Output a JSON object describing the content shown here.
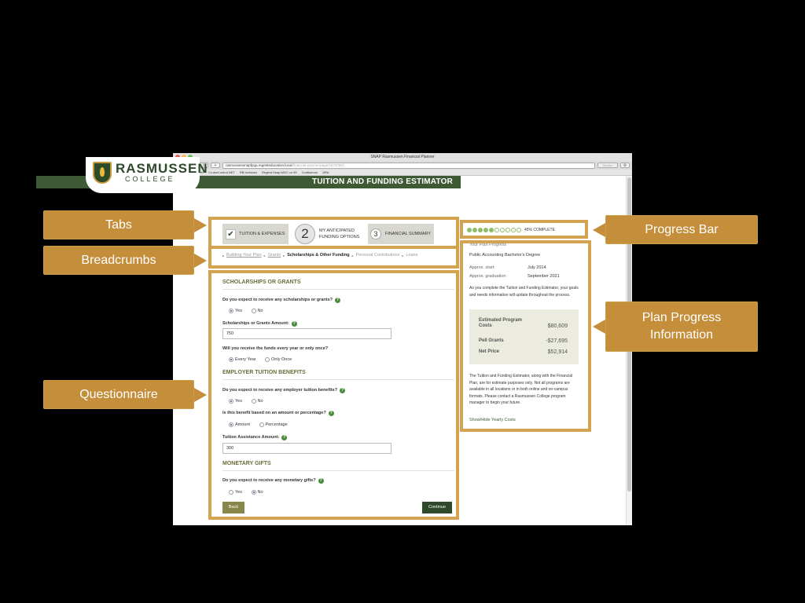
{
  "browser": {
    "window_title": "SNAP Rasmussen Financial Planner",
    "url_host": "rasmussensnapfpqa.regenteducation.local",
    "url_path": "/financial-planner/page/1970/38/1",
    "reader_label": "Reader",
    "bookmarks": [
      "Regent HR",
      "CruiseControl.NET",
      "RB Invisions",
      "Regent.Snap.MVC on 95",
      "Confluence",
      "JIRA"
    ]
  },
  "header": {
    "brand_main": "RASMUSSEN",
    "brand_sub": "COLLEGE",
    "banner_title": "TUITION AND FUNDING ESTIMATOR"
  },
  "tabs": [
    {
      "label": "TUITION & EXPENSES",
      "state": "done"
    },
    {
      "number": "2",
      "label_line1": "MY ANTICIPATED",
      "label_line2": "FUNDING OPTIONS",
      "state": "current"
    },
    {
      "number": "3",
      "label": "FINANCIAL SUMMARY",
      "state": "upcoming"
    }
  ],
  "breadcrumbs": [
    "Building Your Plan",
    "Grants",
    "Scholarships & Other Funding",
    "Personal Contributions",
    "Loans"
  ],
  "progress": {
    "filled": 5,
    "total": 10,
    "label": "45% COMPLETE"
  },
  "questionnaire": {
    "scholarships_section": "SCHOLARSHIPS OR GRANTS",
    "q1": "Do you expect to receive any scholarships or grants?",
    "yes": "Yes",
    "no": "No",
    "amount_label": "Scholarships or Grants Amount:",
    "amount_value": "750",
    "q2": "Will you receive the funds every year or only once?",
    "every_year": "Every Year",
    "only_once": "Only Once",
    "employer_section": "EMPLOYER TUITION BENEFITS",
    "q3": "Do you expect to receive any employer tuition benefits?",
    "q4": "Is this benefit based on an amount or percentage?",
    "amount_opt": "Amount",
    "percentage_opt": "Percentage",
    "tuition_label": "Tuition Assistance Amount:",
    "tuition_value": "300",
    "gifts_section": "MONETARY GIFTS",
    "q5": "Do you expect to receive any monetary gifts?",
    "back": "Back",
    "continue": "Continue"
  },
  "plan": {
    "heading": "Your Plan Progress",
    "degree": "Public Accounting Bachelor's Degree",
    "start_label": "Approx. start:",
    "start_value": "July 2014",
    "grad_label": "Approx. graduation:",
    "grad_value": "September 2021",
    "intro": "As you complete the Tuition and Funding Estimator, your goals and needs information will update throughout the process.",
    "est_label_1": "Estimated Program",
    "est_label_2": "Costs",
    "est_value": "$80,609",
    "pell_label": "Pell Grants",
    "pell_value": "-$27,695",
    "net_label": "Net Price",
    "net_value": "$52,914",
    "disclaimer": "The Tuition and Funding Estimator, along with the Financial Plan, are for estimate purposes only. Not all programs are available in all locations or in both online and on-campus formats. Please contact a Rasmussen College program manager to begin your future.",
    "toggle_link": "Show/Hide Yearly Costs"
  },
  "annotations": {
    "tabs": "Tabs",
    "breadcrumbs": "Breadcrumbs",
    "questionnaire": "Questionnaire",
    "progress_bar": "Progress Bar",
    "plan_info_1": "Plan Progress",
    "plan_info_2": "Information"
  },
  "colors": {
    "brand_green": "#3d5a35",
    "callout_gold": "#c48e3a",
    "outline_gold": "#d3a350",
    "section_olive": "#6b6d3a",
    "progress_green": "#8ebd6b"
  }
}
